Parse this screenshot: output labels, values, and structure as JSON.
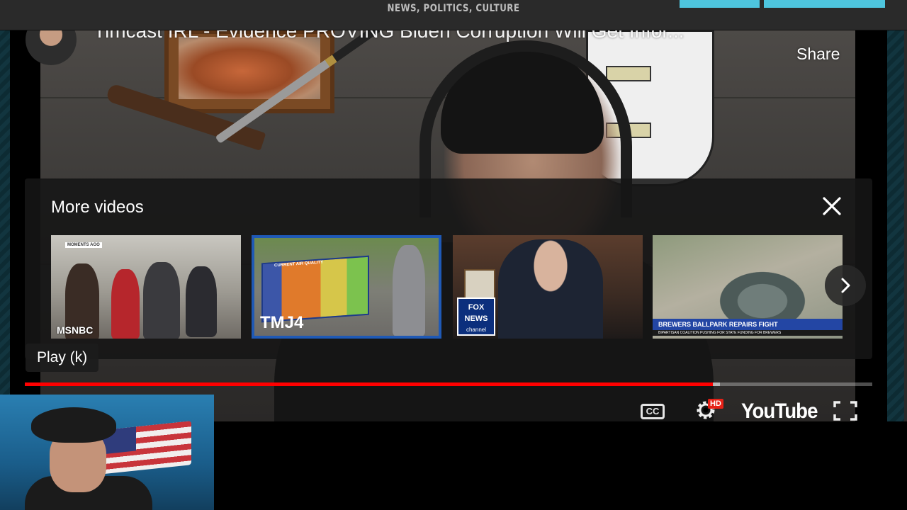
{
  "site": {
    "tagline": "NEWS, POLITICS, CULTURE"
  },
  "player": {
    "title": "Timcast IRL - Evidence PROVING Biden Corruption Will Get Infor...",
    "share_label": "Share",
    "more_videos_title": "More videos",
    "tooltip": "Play (k)",
    "progress": {
      "played_percent": 81.2,
      "buffered_percent": 82.0
    },
    "cc_label": "CC",
    "hd_badge": "HD",
    "logo_text": "YouTube",
    "suggested": [
      {
        "network": "MSNBC",
        "tag": "MOMENTS AGO"
      },
      {
        "network": "TMJ4",
        "tag": "CURRENT AIR QUALITY"
      },
      {
        "network": "FOX NEWS",
        "network_sub": "channel"
      },
      {
        "headline": "BREWERS BALLPARK REPAIRS FIGHT",
        "subheadline": "BIPARTISAN COALITION PUSHING FOR STATE FUNDING FOR BREWERS"
      }
    ]
  },
  "colors": {
    "accent": "#4ec5de",
    "progress": "#ff0000",
    "hd": "#e62117",
    "selected_thumb_border": "#1f59b5"
  }
}
